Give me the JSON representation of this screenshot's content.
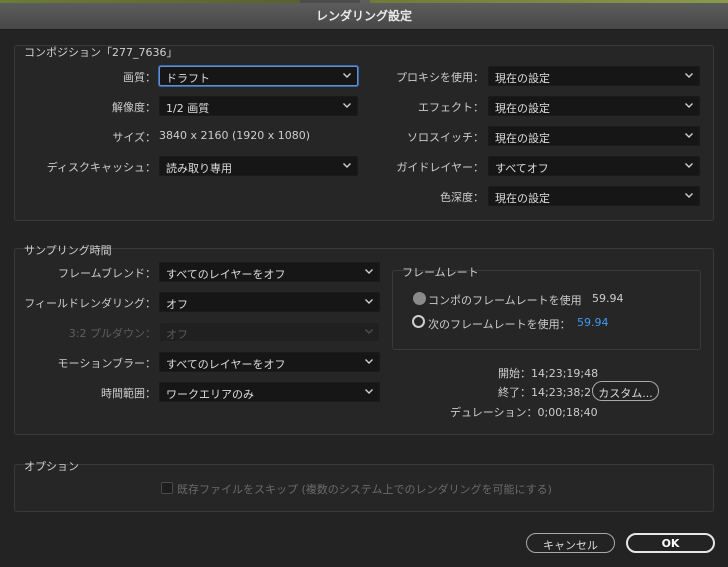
{
  "window": {
    "title": "レンダリング設定"
  },
  "composition": {
    "legend": "コンポジション「277_7636」",
    "quality": {
      "label": "画質：",
      "value": "ドラフト"
    },
    "resolution": {
      "label": "解像度：",
      "value": "1/2 画質"
    },
    "size": {
      "label": "サイズ：",
      "value": "3840 x 2160 (1920 x 1080)"
    },
    "disk_cache": {
      "label": "ディスクキャッシュ：",
      "value": "読み取り専用"
    },
    "proxy": {
      "label": "プロキシを使用：",
      "value": "現在の設定"
    },
    "effects": {
      "label": "エフェクト：",
      "value": "現在の設定"
    },
    "solo": {
      "label": "ソロスイッチ：",
      "value": "現在の設定"
    },
    "guide_layers": {
      "label": "ガイドレイヤー：",
      "value": "すべてオフ"
    },
    "color_depth": {
      "label": "色深度：",
      "value": "現在の設定"
    }
  },
  "sampling": {
    "legend": "サンプリング時間",
    "frame_blend": {
      "label": "フレームブレンド：",
      "value": "すべてのレイヤーをオフ"
    },
    "field_render": {
      "label": "フィールドレンダリング：",
      "value": "オフ"
    },
    "pulldown": {
      "label": "3:2 プルダウン：",
      "value": "オフ"
    },
    "motion_blur": {
      "label": "モーションブラー：",
      "value": "すべてのレイヤーをオフ"
    },
    "time_span": {
      "label": "時間範囲：",
      "value": "ワークエリアのみ"
    },
    "frame_rate": {
      "legend": "フレームレート",
      "use_comp": {
        "label": "コンポのフレームレートを使用",
        "value": "59.94"
      },
      "use_this": {
        "label": "次のフレームレートを使用：",
        "value": "59.94"
      }
    },
    "start": "開始：14;23;19;48",
    "end": "終了：14;23;38;27",
    "custom_button": "カスタム...",
    "duration": "デュレーション：0;00;18;40"
  },
  "options": {
    "legend": "オプション",
    "skip_existing": "既存ファイルをスキップ (複数のシステム上でのレンダリングを可能にする)"
  },
  "footer": {
    "cancel": "キャンセル",
    "ok": "OK"
  },
  "icons": {
    "dropdown": "chevron-down-icon"
  },
  "colors": {
    "focus": "#5f8fd0",
    "link": "#3e9bf0"
  }
}
